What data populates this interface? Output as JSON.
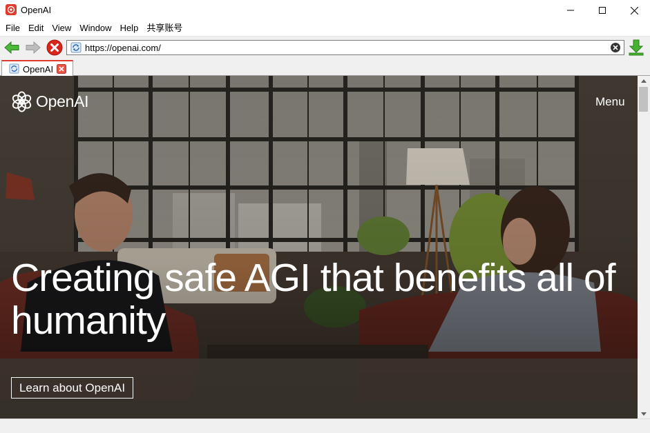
{
  "window": {
    "title": "OpenAI"
  },
  "menubar": {
    "items": [
      "File",
      "Edit",
      "View",
      "Window",
      "Help",
      "共享账号"
    ]
  },
  "toolbar": {
    "url": "https://openai.com/"
  },
  "tabs": [
    {
      "label": "OpenAI"
    }
  ],
  "page": {
    "logo_text": "OpenAI",
    "menu_label": "Menu",
    "headline": "Creating safe AGI that benefits all of humanity",
    "cta_label": "Learn about OpenAI"
  },
  "colors": {
    "accent_red": "#e03a2f",
    "nav_green": "#3aa531",
    "stop_red": "#d9261c",
    "download_green": "#3fae2a"
  },
  "icons": [
    "openai-logo-icon",
    "back-arrow-icon",
    "forward-arrow-icon",
    "stop-icon",
    "refresh-icon",
    "clear-icon",
    "download-icon",
    "tab-close-icon"
  ]
}
